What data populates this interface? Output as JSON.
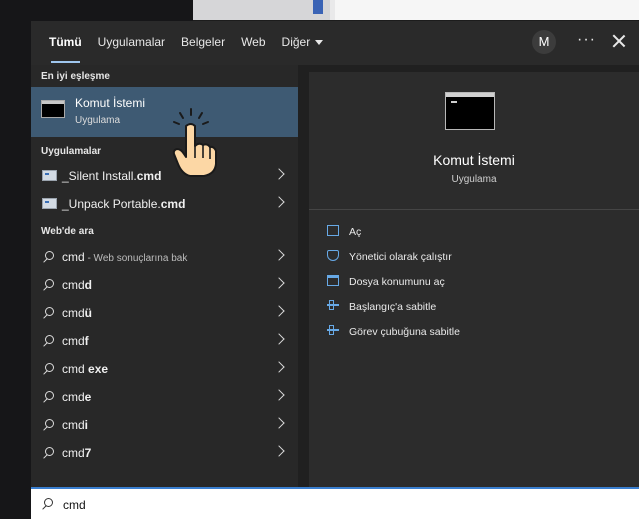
{
  "tabs": [
    {
      "label": "Tümü"
    },
    {
      "label": "Uygulamalar"
    },
    {
      "label": "Belgeler"
    },
    {
      "label": "Web"
    },
    {
      "label": "Diğer"
    }
  ],
  "header": {
    "avatar_letter": "M",
    "more_label": "···"
  },
  "sections": {
    "best_match": "En iyi eşleşme",
    "apps": "Uygulamalar",
    "web": "Web'de ara"
  },
  "best_match": {
    "title": "Komut İstemi",
    "subtitle": "Uygulama"
  },
  "apps": [
    {
      "prefix": "_Silent Install.",
      "bold": "cmd"
    },
    {
      "prefix": "_Unpack Portable.",
      "bold": "cmd"
    }
  ],
  "web_results": [
    {
      "prefix": "cmd",
      "bold": "",
      "hint": " - Web sonuçlarına bak"
    },
    {
      "prefix": "cmd",
      "bold": "d",
      "hint": ""
    },
    {
      "prefix": "cmd",
      "bold": "ü",
      "hint": ""
    },
    {
      "prefix": "cmd",
      "bold": "f",
      "hint": ""
    },
    {
      "prefix": "cmd ",
      "bold": "exe",
      "hint": ""
    },
    {
      "prefix": "cmd",
      "bold": "e",
      "hint": ""
    },
    {
      "prefix": "cmd",
      "bold": "i",
      "hint": ""
    },
    {
      "prefix": "cmd",
      "bold": "7",
      "hint": ""
    }
  ],
  "detail": {
    "title": "Komut İstemi",
    "subtitle": "Uygulama",
    "actions": [
      {
        "label": "Aç",
        "icon": "open-icon"
      },
      {
        "label": "Yönetici olarak çalıştır",
        "icon": "shield-icon"
      },
      {
        "label": "Dosya konumunu aç",
        "icon": "folder-icon"
      },
      {
        "label": "Başlangıç'a sabitle",
        "icon": "pin-icon"
      },
      {
        "label": "Görev çubuğuna sabitle",
        "icon": "pin-icon"
      }
    ]
  },
  "search": {
    "value": "cmd"
  },
  "colors": {
    "accent": "#3e5a73",
    "focus": "#3a7fd0",
    "icon_blue": "#67a9e6"
  }
}
